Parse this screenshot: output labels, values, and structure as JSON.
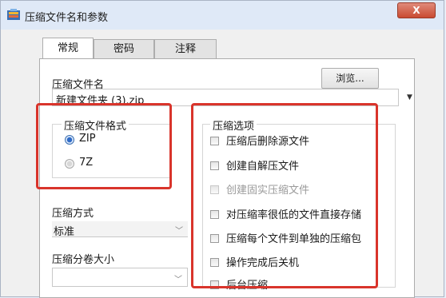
{
  "window": {
    "title": "压缩文件名和参数",
    "close_glyph": "X"
  },
  "tabs": [
    {
      "label": "常规",
      "active": true
    },
    {
      "label": "密码",
      "active": false
    },
    {
      "label": "注释",
      "active": false
    }
  ],
  "filename": {
    "label": "压缩文件名",
    "value": "新建文件夹 (3).zip",
    "browse_label": "浏览..."
  },
  "format_group": {
    "title": "压缩文件格式",
    "options": [
      {
        "label": "ZIP",
        "selected": true
      },
      {
        "label": "7Z",
        "selected": false
      }
    ]
  },
  "options_group": {
    "title": "压缩选项",
    "items": [
      {
        "label": "压缩后删除源文件",
        "enabled": true
      },
      {
        "label": "创建自解压文件",
        "enabled": true
      },
      {
        "label": "创建固实压缩文件",
        "enabled": false
      },
      {
        "label": "对压缩率很低的文件直接存储",
        "enabled": true
      },
      {
        "label": "压缩每个文件到单独的压缩包",
        "enabled": true
      },
      {
        "label": "操作完成后关机",
        "enabled": true
      },
      {
        "label": "后台压缩",
        "enabled": true
      }
    ]
  },
  "method": {
    "label": "压缩方式",
    "value": "标准"
  },
  "volume": {
    "label": "压缩分卷大小",
    "value": ""
  },
  "colors": {
    "highlight": "#d9342b",
    "titlebar": "#dfe9f7",
    "radio_selected": "#2f6bc7"
  }
}
